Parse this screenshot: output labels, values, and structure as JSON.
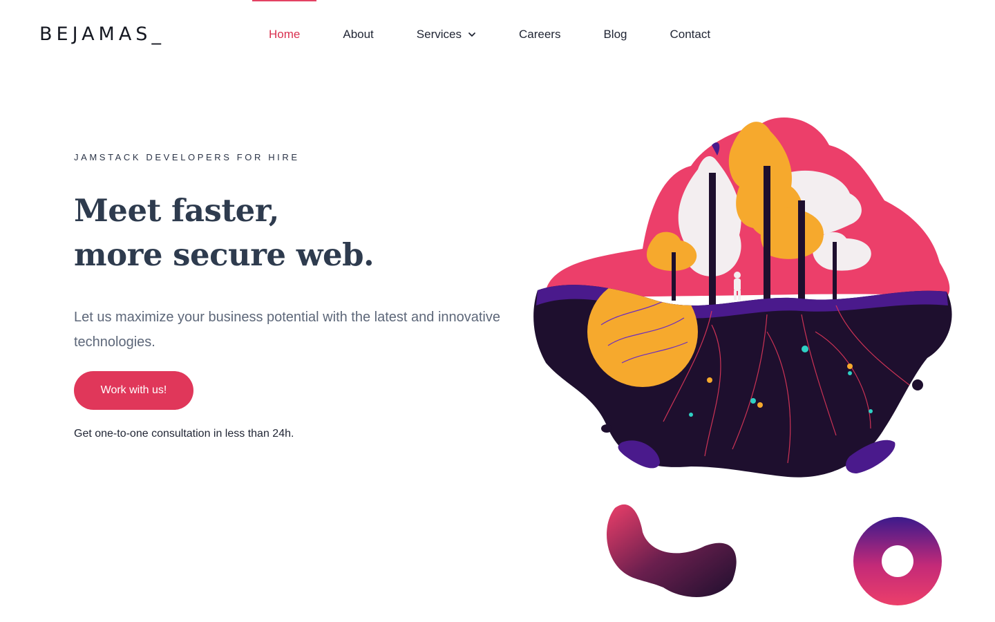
{
  "header": {
    "logo": "BEJAMAS_",
    "nav": [
      {
        "label": "Home",
        "active": true
      },
      {
        "label": "About",
        "active": false
      },
      {
        "label": "Services",
        "active": false,
        "dropdown": true
      },
      {
        "label": "Careers",
        "active": false
      },
      {
        "label": "Blog",
        "active": false
      },
      {
        "label": "Contact",
        "active": false
      }
    ]
  },
  "hero": {
    "eyebrow": "JAMSTACK DEVELOPERS FOR HIRE",
    "headline_line1": "Meet faster,",
    "headline_line2": "more secure web.",
    "lead": "Let us maximize your business potential with the latest and innovative technologies.",
    "cta_label": "Work with us!",
    "note": "Get one-to-one consultation in less than 24h."
  },
  "icons": {
    "services_dropdown": "chevron-down-icon"
  },
  "colors": {
    "accent": "#e0375a",
    "heading": "#2e3b4e",
    "text": "#1f2433",
    "muted": "#5d6779",
    "illustration_pink": "#ec3f6a",
    "illustration_yellow": "#f6a92d",
    "illustration_dark": "#1e0f2e",
    "illustration_purple": "#4a1a8c"
  }
}
